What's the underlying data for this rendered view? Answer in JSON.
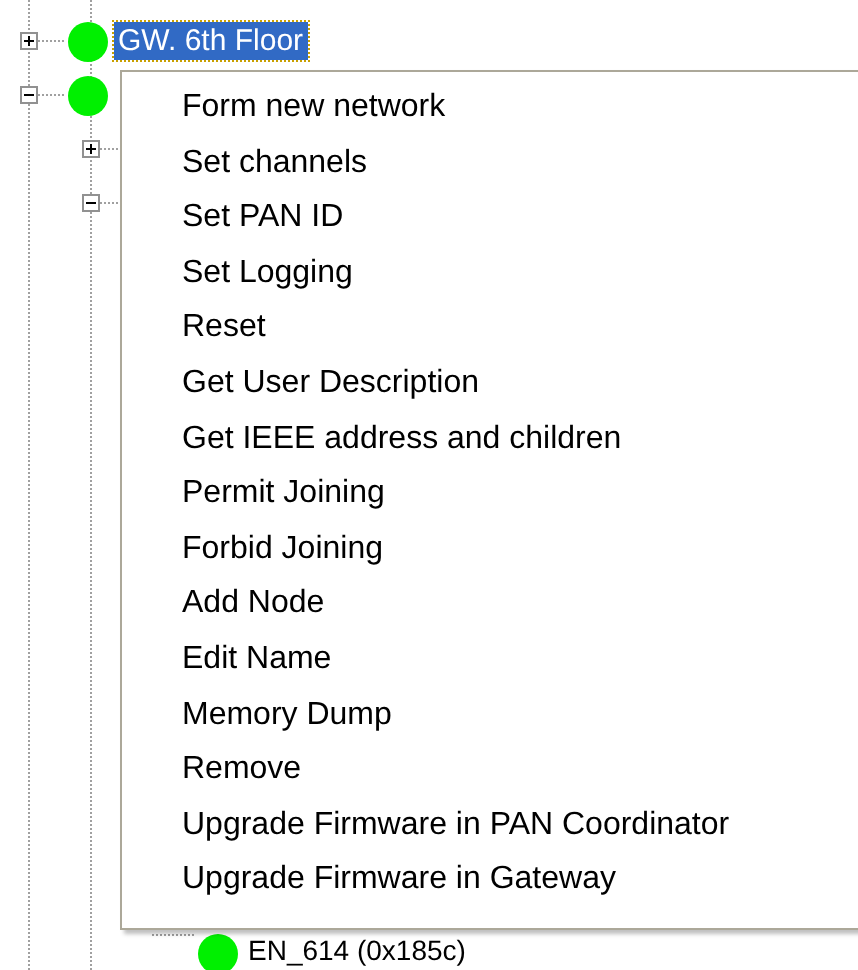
{
  "tree": [
    {
      "label": "GW. 6th Floor",
      "expanded": false,
      "selected": true
    },
    {
      "expanded": true,
      "children": [
        {
          "expanded": false
        },
        {
          "expanded": true,
          "children": [
            {
              "label": "EN_614 (0x185c)",
              "selected": false
            }
          ]
        }
      ]
    }
  ],
  "context_menu": {
    "items": [
      {
        "label": "Form new network"
      },
      {
        "label": "Set channels"
      },
      {
        "label": "Set PAN ID"
      },
      {
        "label": "Set Logging"
      },
      {
        "label": "Reset"
      },
      {
        "label": "Get User Description"
      },
      {
        "label": "Get IEEE address and children"
      },
      {
        "label": "Permit Joining"
      },
      {
        "label": "Forbid Joining"
      },
      {
        "label": "Add Node"
      },
      {
        "label": "Edit Name"
      },
      {
        "label": "Memory Dump"
      },
      {
        "label": "Remove"
      },
      {
        "label": "Upgrade Firmware in PAN Coordinator"
      },
      {
        "label": "Upgrade Firmware in Gateway"
      }
    ]
  }
}
